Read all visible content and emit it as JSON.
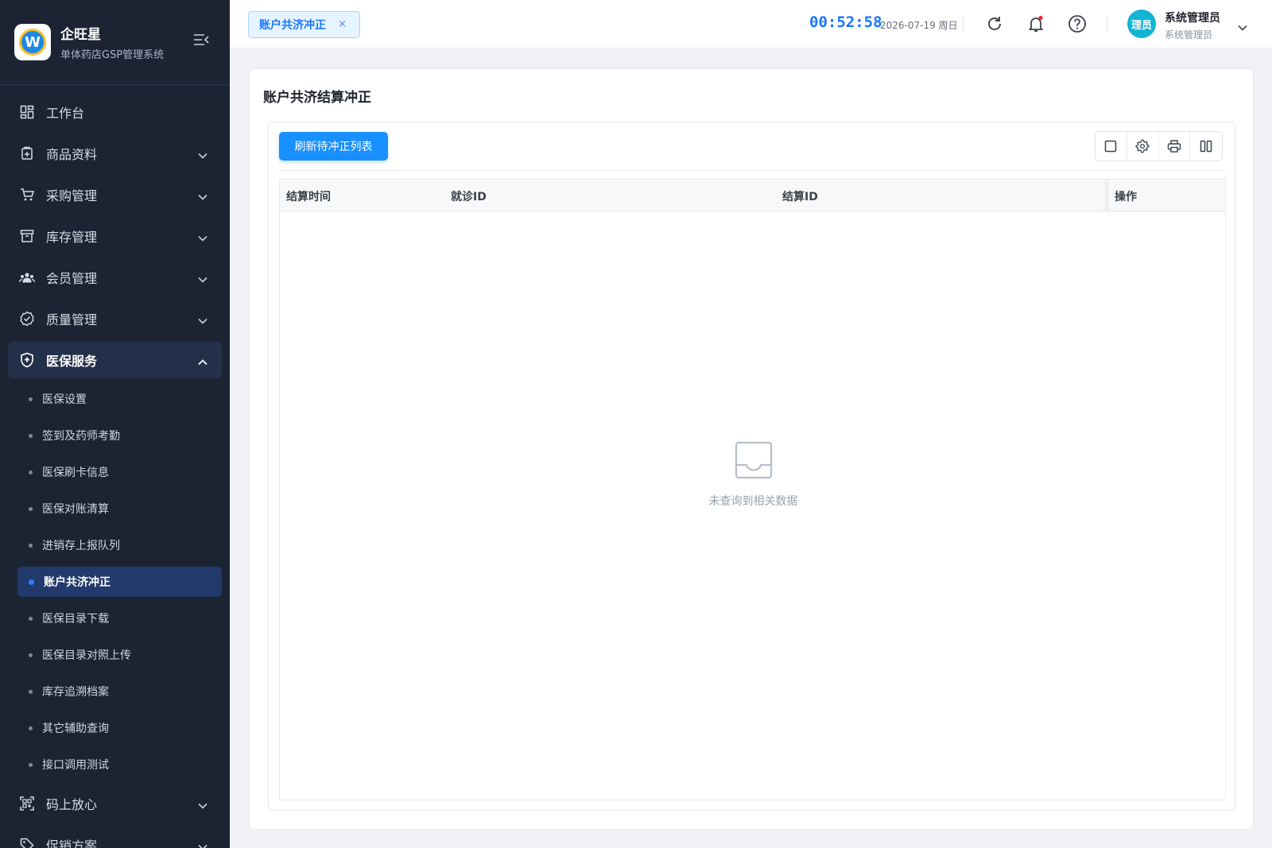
{
  "brand": {
    "title": "企旺星",
    "subtitle": "单体药店GSP管理系统",
    "logo_letter": "W"
  },
  "sidebar": {
    "items": [
      {
        "label": "工作台",
        "icon": "dashboard-icon"
      },
      {
        "label": "商品资料",
        "icon": "product-icon"
      },
      {
        "label": "采购管理",
        "icon": "cart-icon"
      },
      {
        "label": "库存管理",
        "icon": "inventory-icon"
      },
      {
        "label": "会员管理",
        "icon": "members-icon"
      },
      {
        "label": "质量管理",
        "icon": "quality-icon"
      },
      {
        "label": "医保服务",
        "icon": "shield-icon",
        "expanded": true
      },
      {
        "label": "码上放心",
        "icon": "qr-code-icon"
      },
      {
        "label": "促销方案",
        "icon": "tag-icon"
      }
    ],
    "sub_items": [
      "医保设置",
      "签到及药师考勤",
      "医保刷卡信息",
      "医保对账清算",
      "进销存上报队列",
      "账户共济冲正",
      "医保目录下载",
      "医保目录对照上传",
      "库存追溯档案",
      "其它辅助查询",
      "接口调用测试"
    ],
    "active_sub_item": "账户共济冲正"
  },
  "header": {
    "tab_label": "账户共济冲正",
    "tab_close": "×",
    "clock": "00:52:58",
    "date": "2026-07-19 周日",
    "user": {
      "avatar_text": "理员",
      "name": "系统管理员",
      "role": "系统管理员"
    }
  },
  "main": {
    "page_title": "账户共济结算冲正",
    "refresh_button": "刷新待冲正列表",
    "table": {
      "columns": [
        "结算时间",
        "就诊ID",
        "结算ID",
        "操作"
      ],
      "rows": [],
      "empty_text": "未查询到相关数据"
    }
  },
  "colors": {
    "primary": "#1890ff",
    "sidebar_bg": "#1c2434",
    "active_sub_bg": "#223a6b",
    "avatar_bg": "#12b4d4",
    "notify_dot": "#f5222d"
  }
}
